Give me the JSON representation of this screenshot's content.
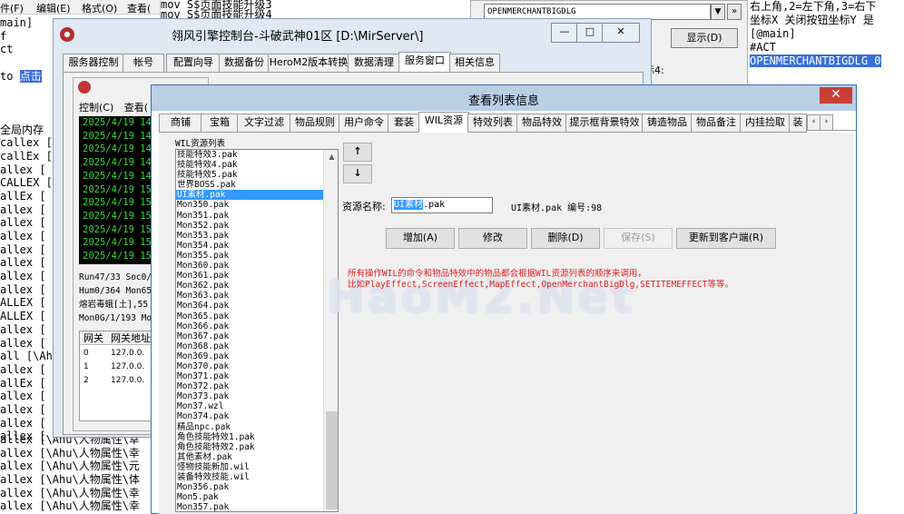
{
  "bg_editor": {
    "menu": [
      "件(F)",
      "编辑(E)",
      "格式(O)",
      "查看("
    ],
    "lines_top": [
      "main]",
      "f",
      "ct",
      "",
      "to 点击",
      "",
      "",
      "",
      "全局内存",
      "callex [",
      "callEx [",
      "allex [",
      "CALLEX [",
      "allEx [",
      "allex [",
      "allex [",
      "allex [",
      "allex [",
      "allex [",
      "allex [",
      "allex [",
      "ALLEX [",
      "ALLEX [",
      "allex [",
      "allex [",
      "all [\\Ah",
      "allex [",
      "allEx [",
      "allex [",
      "allex [",
      "allex [",
      "allex ["
    ],
    "lines_bottom": [
      "allex [\\Ahu\\人物属性\\幸",
      "allex [\\Ahu\\人物属性\\幸",
      "allex [\\Ahu\\人物属性\\元",
      "allex [\\Ahu\\人物属性\\体",
      "allex [\\Ahu\\人物属性\\幸",
      "allex [\\Ahu\\人物属性\\幸"
    ]
  },
  "mid_editor": [
    "mov  S$页面技能升级3",
    "mov  S$页面技能升级4"
  ],
  "right_dialog": {
    "combo_value": "OPENMERCHANTBIGDLG",
    "show_button": "显示(D)",
    "label": "坐标4:"
  },
  "far_right": [
    "右上角,2=左下角,3=右下",
    "坐标X 关闭按钮坐标Y 是",
    "",
    "[@main]",
    "#ACT",
    "OPENMERCHANTBIGDLG 0 "
  ],
  "console": {
    "title": "翎风引擎控制台-斗破武神01区 [D:\\MirServer\\]",
    "tabs": [
      "服务器控制",
      "帐号",
      "配置向导",
      "数据备份",
      "HeroM2版本转换",
      "数据清理",
      "服务窗口",
      "相关信息"
    ],
    "active_tab": 6,
    "inner_menu": [
      "控制(C)",
      "查看("
    ],
    "log_lines": [
      "2025/4/19 14",
      "2025/4/19 14",
      "2025/4/19 14",
      "2025/4/19 14",
      "2025/4/19 14",
      "2025/4/19 15",
      "2025/4/19 15",
      "2025/4/19 15",
      "2025/4/19 15",
      "2025/4/19 15",
      "2025/4/19 15"
    ],
    "stats": [
      "Run47/33 Soc0/0",
      "Hum0/364 Mon65/",
      "熔岩毒蛾[土],55",
      "Mon0G/1/193 Mon"
    ],
    "gateway_headers": [
      "网关",
      "网关地址"
    ],
    "gateway_rows": [
      [
        "0",
        "127.0.0."
      ],
      [
        "1",
        "127.0.0."
      ],
      [
        "2",
        "127.0.0."
      ]
    ]
  },
  "dialog": {
    "title": "查看列表信息",
    "tabs": [
      "商铺",
      "宝箱",
      "文字过滤",
      "物品规则",
      "用户命令",
      "套装",
      "WIL资源",
      "特效列表",
      "物品特效",
      "提示框背景特效",
      "铸造物品",
      "物品备注",
      "内挂捡取",
      "装"
    ],
    "active_tab": 6,
    "group_label": "WIL资源列表",
    "wil_items": [
      "技能特效3.pak",
      "技能特效4.pak",
      "技能特效5.pak",
      "世界BOSS.pak",
      "UI素材.pak",
      "Mon350.pak",
      "Mon351.pak",
      "Mon352.pak",
      "Mon353.pak",
      "Mon354.pak",
      "Mon355.pak",
      "Mon360.pak",
      "Mon361.pak",
      "Mon362.pak",
      "Mon363.pak",
      "Mon364.pak",
      "Mon365.pak",
      "Mon366.pak",
      "Mon367.pak",
      "Mon368.pak",
      "Mon369.pak",
      "Mon370.pak",
      "Mon371.pak",
      "Mon372.pak",
      "Mon373.pak",
      "Mon37.wzl",
      "Mon374.pak",
      "精品npc.pak",
      "角色技能特效1.pak",
      "角色技能特效2.pak",
      "其他素材.pak",
      "怪物技能新加.wil",
      "装备特效技能.wil",
      "Mon356.pak",
      "Mon5.pak",
      "Mon357.pak"
    ],
    "selected_index": 4,
    "up_button": "↑",
    "down_button": "↓",
    "res_label": "资源名称:",
    "res_value_hl": "UI素材",
    "res_value_rest": ".pak",
    "res_info": "UI素材.pak 编号:98",
    "buttons": {
      "add": "增加(A)",
      "edit": "修改",
      "delete": "删除(D)",
      "save": "保存(S)",
      "update": "更新到客户端(R)"
    },
    "note_lines": [
      "所有操作WIL的命令和物品特效中的物品都会根据WIL资源列表的顺序来调用，",
      "比如PlayEffect,ScreenEffect,MapEffect,OpenMerchantBigDlg,SETITEMEFFECT等等。"
    ],
    "watermark": "HaoM2.Net"
  },
  "colors": {
    "title_bar": "#b8cfe6",
    "close_red": "#c83d35",
    "selection": "#3399ff",
    "note_red": "#e02020",
    "log_green": "#38d838"
  }
}
